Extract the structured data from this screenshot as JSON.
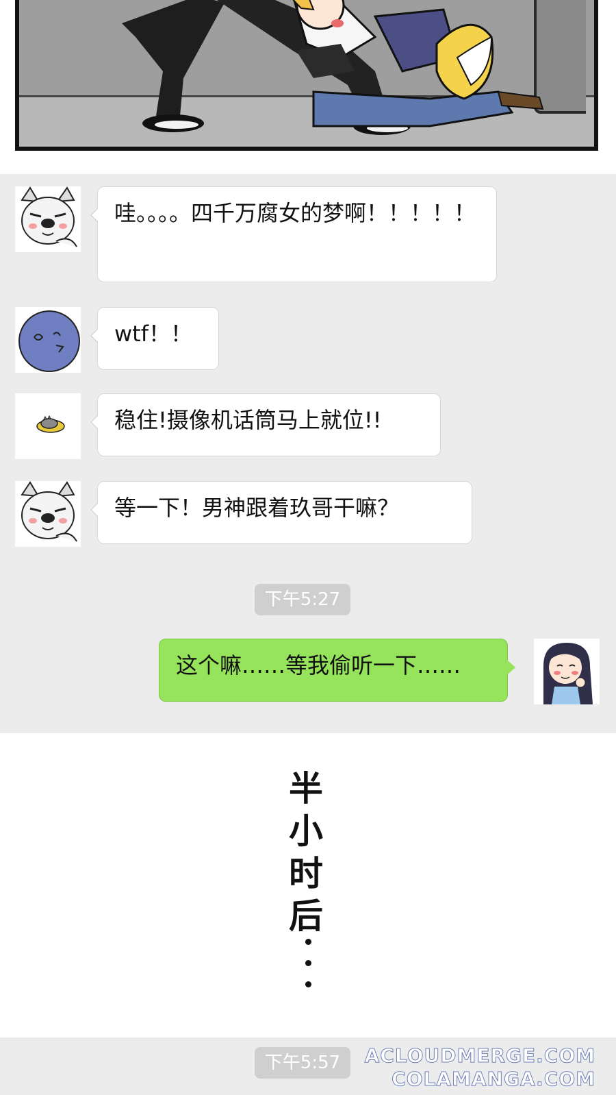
{
  "chat": {
    "messages": [
      {
        "side": "left",
        "avatar": "husky-avatar",
        "text": "哇。。。。四千万腐女的梦啊！！！！！"
      },
      {
        "side": "left",
        "avatar": "blue-face-avatar",
        "text": "wtf！！"
      },
      {
        "side": "left",
        "avatar": "cat-plate-avatar",
        "text": "稳住!摄像机话筒马上就位!!"
      },
      {
        "side": "left",
        "avatar": "husky-avatar",
        "text": "等一下！男神跟着玖哥干嘛？"
      }
    ],
    "timestamp_1": "下午5:27",
    "reply": {
      "side": "right",
      "avatar": "girl-avatar",
      "text": "这个嘛……等我偷听一下……"
    },
    "timestamp_2": "下午5:57"
  },
  "narration": {
    "text": "半\n小\n时\n后"
  },
  "watermark": {
    "line1": "ACLOUDMERGE.COM",
    "line2": "COLAMANGA.COM"
  },
  "colors": {
    "chat_bg": "#ececec",
    "bubble_left": "#ffffff",
    "bubble_right": "#96e35c",
    "timestamp_bg": "#cfcfcf"
  }
}
